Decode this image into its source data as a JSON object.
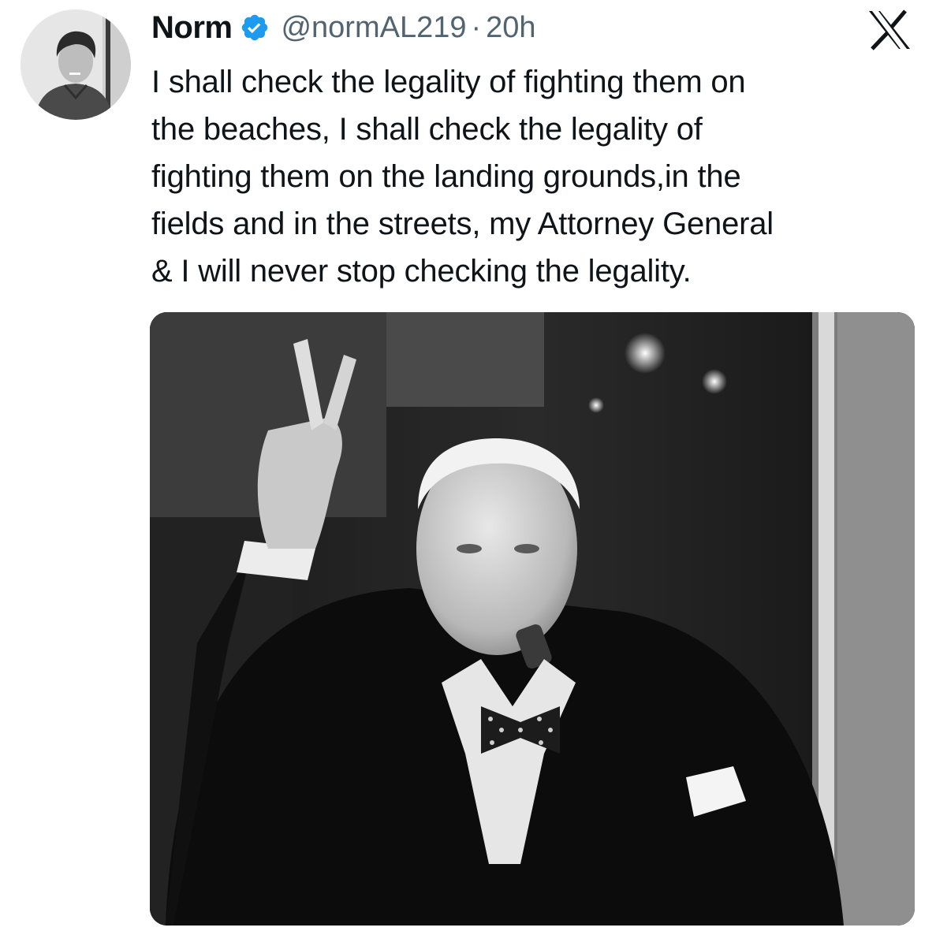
{
  "tweet": {
    "author": {
      "display_name": "Norm",
      "handle": "@normAL219",
      "verified": true,
      "avatar_icon": "user-avatar-photo"
    },
    "separator": "·",
    "time": "20h",
    "platform_icon": "x-logo-icon",
    "text": "I shall check the legality of fighting them on\nthe beaches, I shall check the legality of\nfighting them on the landing grounds,in the\nfields and in the streets, my Attorney General\n& I will never stop checking the legality.",
    "media": {
      "type": "black-and-white photo",
      "icon": "media-photo"
    }
  },
  "colors": {
    "text": "#0f1419",
    "secondary": "#536471",
    "verified": "#1d9bf0"
  }
}
